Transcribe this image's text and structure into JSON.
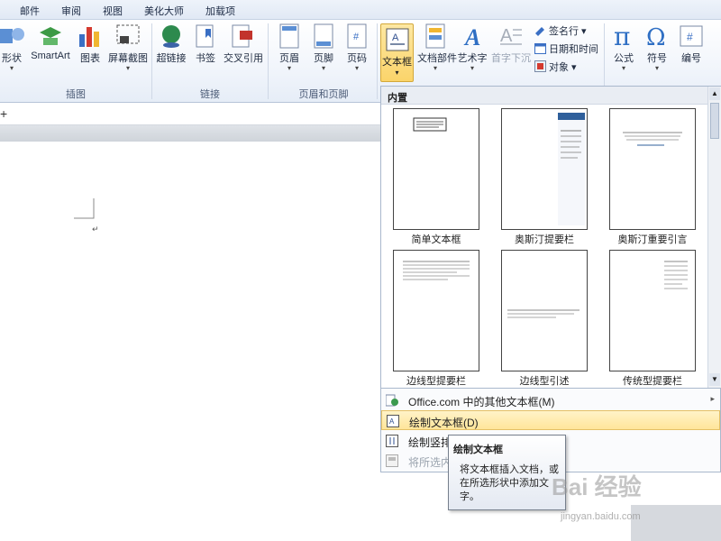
{
  "tabs": [
    "邮件",
    "审阅",
    "视图",
    "美化大师",
    "加载项"
  ],
  "ribbon": {
    "buttons": {
      "shapes": "形状",
      "smartart": "SmartArt",
      "chart": "图表",
      "screenshot": "屏幕截图",
      "hyperlink": "超链接",
      "bookmark": "书签",
      "crossref": "交叉引用",
      "header": "页眉",
      "footer": "页脚",
      "pagenum": "页码",
      "textbox": "文本框",
      "quickparts": "文档部件",
      "wordart": "艺术字",
      "dropcap": "首字下沉",
      "signature": "签名行",
      "datetime": "日期和时间",
      "object": "对象",
      "equation": "公式",
      "symbol": "符号",
      "numbering": "编号"
    },
    "groups": {
      "illustrations": "插图",
      "links": "链接",
      "header_footer": "页眉和页脚"
    }
  },
  "gallery": {
    "section": "内置",
    "items": [
      "简单文本框",
      "奥斯汀提要栏",
      "奥斯汀重要引言",
      "边线型提要栏",
      "边线型引述",
      "传统型提要栏"
    ]
  },
  "menu": {
    "more": "Office.com 中的其他文本框(M)",
    "draw": "绘制文本框(D)",
    "draw_vertical": "绘制竖排",
    "save_selection": "将所选内"
  },
  "tooltip": {
    "title": "绘制文本框",
    "body": "将文本框插入文档，或在所选形状中添加文字。"
  },
  "watermark": {
    "brand": "Bai 经验",
    "url": "jingyan.baidu.com"
  },
  "colors": {
    "accent": "#fbd46a",
    "ribbon": "#f1f5fb",
    "blue": "#2f5f9b"
  }
}
